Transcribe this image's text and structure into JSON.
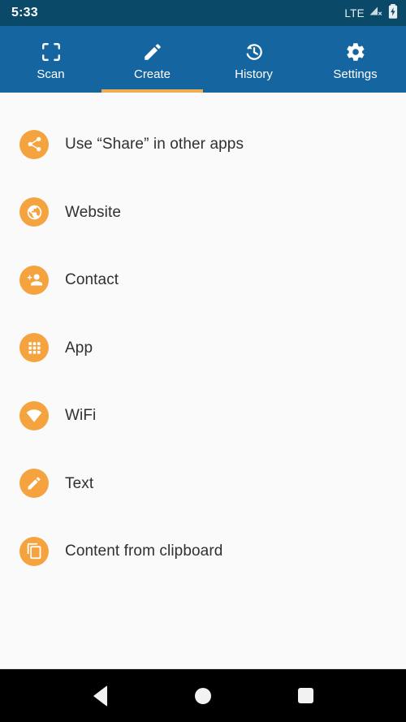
{
  "status_bar": {
    "time": "5:33",
    "network_label": "LTE",
    "signal_icon": "signal-no-service-icon",
    "battery_icon": "battery-charging-icon",
    "background_color": "#0a4a68"
  },
  "tab_bar": {
    "background_color": "#1565a0",
    "active_indicator_color": "#eead54",
    "active_index": 1,
    "tabs": [
      {
        "label": "Scan",
        "icon": "scan-frame-icon",
        "active": false
      },
      {
        "label": "Create",
        "icon": "pencil-icon",
        "active": true
      },
      {
        "label": "History",
        "icon": "history-clock-icon",
        "active": false
      },
      {
        "label": "Settings",
        "icon": "gear-icon",
        "active": false
      }
    ]
  },
  "create_list": {
    "badge_color": "#f5a33f",
    "items": [
      {
        "label": "Use “Share” in other apps",
        "icon": "share-icon"
      },
      {
        "label": "Website",
        "icon": "globe-icon"
      },
      {
        "label": "Contact",
        "icon": "person-add-icon"
      },
      {
        "label": "App",
        "icon": "apps-grid-icon"
      },
      {
        "label": "WiFi",
        "icon": "wifi-icon"
      },
      {
        "label": "Text",
        "icon": "pencil-icon"
      },
      {
        "label": "Content from clipboard",
        "icon": "content-copy-icon"
      }
    ]
  },
  "nav_bar": {
    "background_color": "#000000",
    "buttons": [
      {
        "name": "back",
        "icon": "triangle-back-icon"
      },
      {
        "name": "home",
        "icon": "circle-home-icon"
      },
      {
        "name": "recent",
        "icon": "square-recents-icon"
      }
    ]
  }
}
